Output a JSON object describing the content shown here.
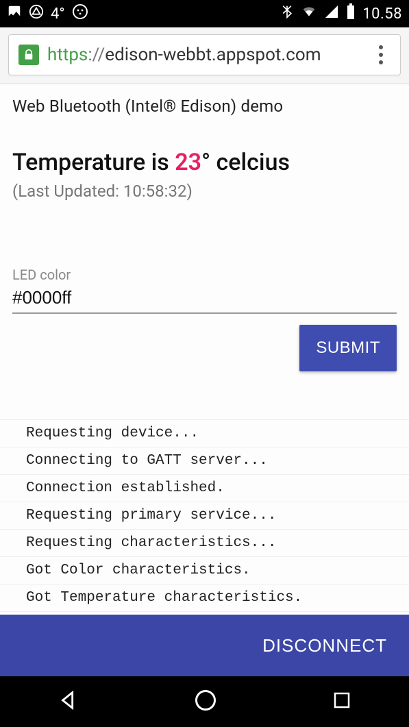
{
  "status_bar": {
    "temp": "4°",
    "time": "10.58"
  },
  "url_bar": {
    "scheme": "https",
    "sep": "://",
    "host": "edison-webbt.appspot.com"
  },
  "page": {
    "demo_title": "Web Bluetooth (Intel® Edison) demo",
    "temp_prefix": "Temperature is ",
    "temp_value": "23",
    "temp_suffix": "° celcius",
    "last_updated": "(Last Updated: 10:58:32)",
    "led_label": "LED color",
    "led_value": "#0000ff",
    "submit_label": "SUBMIT"
  },
  "log": [
    "Requesting device...",
    "Connecting to GATT server...",
    "Connection established.",
    "Requesting primary service...",
    "Requesting characteristics...",
    "Got Color characteristics.",
    "Got Temperature characteristics."
  ],
  "footer": {
    "disconnect_label": "DISCONNECT"
  }
}
